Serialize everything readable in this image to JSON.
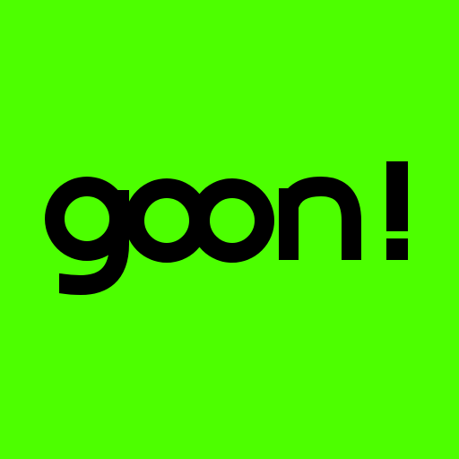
{
  "logo": {
    "wordmark": "goon!",
    "background_color": "#4DFF00",
    "foreground_color": "#000000"
  }
}
